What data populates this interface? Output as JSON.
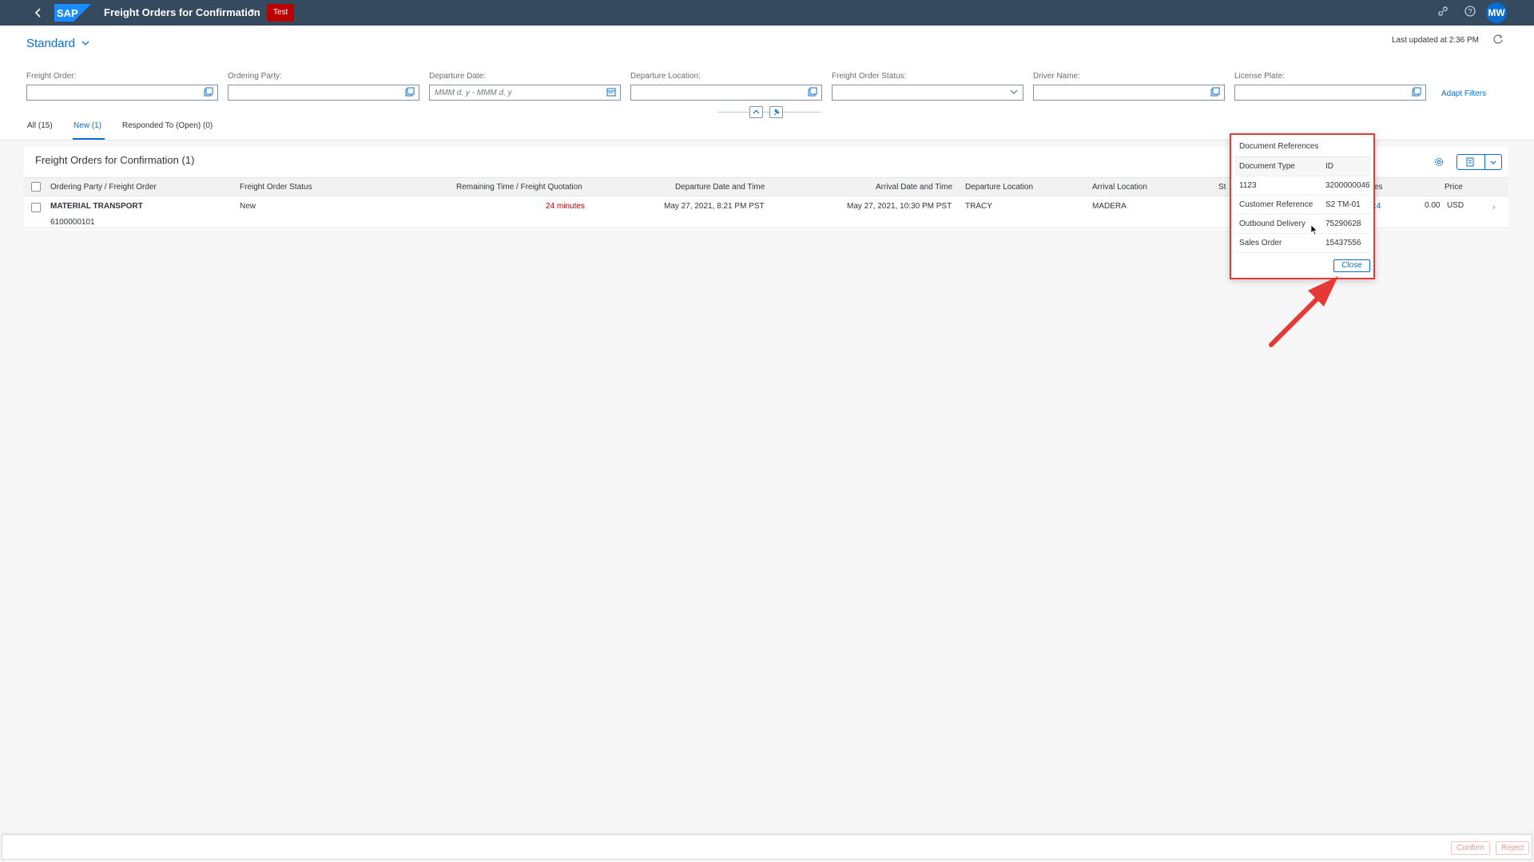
{
  "shell": {
    "logo_text": "SAP",
    "title": "Freight Orders for Confirmation",
    "environment": "Test",
    "avatar_initials": "MW",
    "icons": [
      "back-icon",
      "chevron-down-icon",
      "link-icon",
      "help-icon"
    ]
  },
  "header": {
    "variant": "Standard",
    "last_updated": "Last updated at 2:36 PM"
  },
  "filters": [
    {
      "label": "Freight Order:",
      "value": "",
      "placeholder": ""
    },
    {
      "label": "Ordering Party:",
      "value": "",
      "placeholder": ""
    },
    {
      "label": "Departure Date:",
      "value": "",
      "placeholder": "MMM d, y - MMM d, y"
    },
    {
      "label": "Departure Location:",
      "value": "",
      "placeholder": ""
    },
    {
      "label": "Freight Order Status:",
      "value": "",
      "placeholder": ""
    },
    {
      "label": "Driver Name:",
      "value": "",
      "placeholder": ""
    },
    {
      "label": "License Plate:",
      "value": "",
      "placeholder": ""
    }
  ],
  "adapt_filters_label": "Adapt Filters",
  "tabs": [
    {
      "label": "All (15)"
    },
    {
      "label": "New (1)",
      "active": true
    },
    {
      "label": "Responded To (Open) (0)"
    }
  ],
  "table": {
    "title": "Freight Orders for Confirmation (1)",
    "columns": {
      "party": "Ordering Party / Freight Order",
      "status": "Freight Order Status",
      "remaining": "Remaining Time / Freight Quotation",
      "departure": "Departure Date and Time",
      "arrival": "Arrival Date and Time",
      "dep_loc": "Departure Location",
      "arr_loc": "Arrival Location",
      "st_partial": "St",
      "es_partial": "es",
      "price": "Price"
    },
    "rows": [
      {
        "party": "MATERIAL TRANSPORT",
        "freight_order": "6100000101",
        "status": "New",
        "remaining": "24 minutes",
        "departure": "May 27, 2021, 8:21 PM PST",
        "arrival": "May 27, 2021, 10:30 PM PST",
        "dep_loc": "TRACY",
        "arr_loc": "MADERA",
        "partial_link": ":4",
        "price": "0.00",
        "currency": "USD"
      }
    ]
  },
  "popover": {
    "title": "Document References",
    "headers": {
      "type": "Document Type",
      "id": "ID"
    },
    "rows": [
      {
        "type": "1123",
        "id": "3200000046"
      },
      {
        "type": "Customer Reference",
        "id": "S2 TM-01"
      },
      {
        "type": "Outbound Delivery",
        "id": "75290628"
      },
      {
        "type": "Sales Order",
        "id": "15437556"
      }
    ],
    "close_label": "Close"
  },
  "footer": {
    "confirm_label": "Confirm",
    "reject_label": "Reject"
  },
  "colors": {
    "shell": "#354a5f",
    "accent": "#0a6ed1",
    "env_badge": "#bb0000",
    "highlight": "#e53935"
  }
}
